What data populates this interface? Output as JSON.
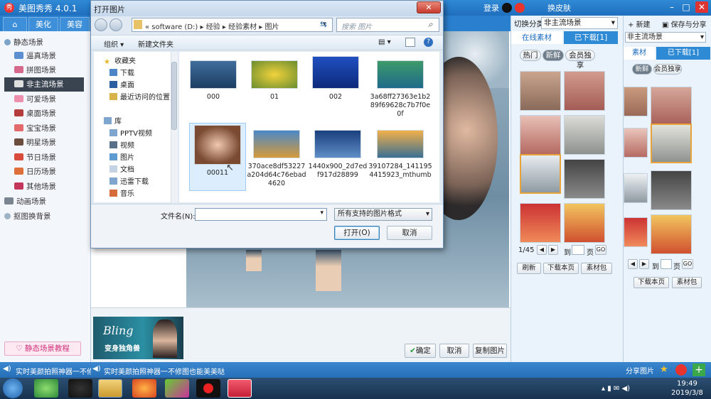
{
  "app": {
    "title": "美图秀秀 4.0.1",
    "login": "登录",
    "sign": "换皮肤"
  },
  "nav": {
    "tabs": [
      "美化",
      "美容"
    ]
  },
  "sidebar": {
    "groups": [
      {
        "label": "静态场景",
        "items": [
          "逼真场景",
          "拼图场景",
          "非主流场景",
          "可爱场景",
          "桌面场景",
          "宝宝场景",
          "明星场景",
          "节日场景",
          "日历场景",
          "其他场景"
        ]
      },
      {
        "label": "动画场景"
      },
      {
        "label": "抠图换背景"
      }
    ],
    "selected": "非主流场景",
    "tutorial": "静态场景教程"
  },
  "banner": {
    "text1": "Bling",
    "text2": "变身独角兽"
  },
  "canvas_buttons": {
    "ok": "确定",
    "cancel": "取消",
    "copy": "复制图片"
  },
  "right_panel": {
    "switch_label": "切换分类",
    "category": "非主流场景",
    "tabs": [
      "在线素材",
      "已下载[1]"
    ],
    "subtabs": [
      "热门",
      "新鲜",
      "会员独享"
    ],
    "pager": {
      "current": "1/45",
      "goto": "到",
      "page": "页",
      "go": "GO"
    },
    "buttons": [
      "刷新",
      "下载本页",
      "素材包"
    ],
    "share": "分享图片"
  },
  "right_panel2": {
    "new": "新建",
    "save": "保存与分享",
    "category": "非主流场景",
    "tabs": [
      "素材",
      "已下载[1]"
    ],
    "subtabs": [
      "新鲜",
      "会员独享"
    ],
    "pager": {
      "goto": "到",
      "page": "页",
      "go": "GO"
    },
    "buttons": [
      "下载本页",
      "素材包"
    ]
  },
  "status": {
    "text": "实时美颜拍照神器一不修图也能美美哒",
    "text_left": "实时美颜拍照神器一不修图"
  },
  "taskbar": {
    "time": "19:49",
    "date": "2019/3/8"
  },
  "dialog": {
    "title": "打开图片",
    "address": [
      "software (D:)",
      "经验",
      "经验素材",
      "图片"
    ],
    "search_placeholder": "搜索 图片",
    "toolbar": {
      "organize": "组织",
      "new_folder": "新建文件夹"
    },
    "tree": {
      "favorites": {
        "label": "收藏夹",
        "items": [
          "下载",
          "桌面",
          "最近访问的位置"
        ]
      },
      "libraries": {
        "label": "库",
        "items": [
          "PPTV视频",
          "视频",
          "图片",
          "文档",
          "迅雷下载",
          "音乐"
        ]
      }
    },
    "files": [
      "000",
      "01",
      "002",
      "3a68ff27363e1b289f69628c7b7f0e0f",
      "00011",
      "370ace8df53227a204d64c76ebad4620",
      "1440x900_2d7edf917d28899",
      "39107284_1411954415923_mthumb"
    ],
    "filename_label": "文件名(N):",
    "filetype": "所有支持的图片格式",
    "open": "打开(O)",
    "cancel": "取消"
  }
}
